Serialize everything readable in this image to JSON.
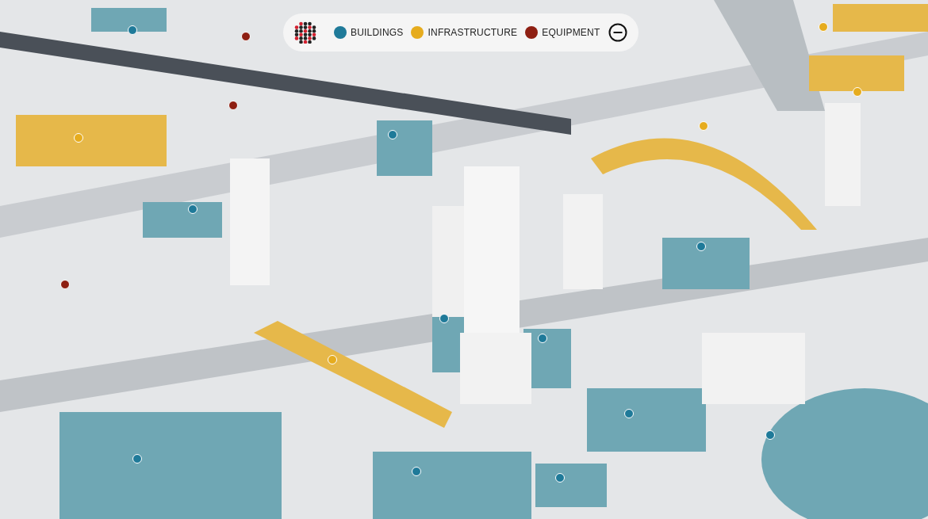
{
  "legend": {
    "items": [
      {
        "label": "BUILDINGS",
        "color": "#1f7a99"
      },
      {
        "label": "INFRASTRUCTURE",
        "color": "#e6ac1e"
      },
      {
        "label": "EQUIPMENT",
        "color": "#8e1f12"
      }
    ]
  },
  "pins": [
    {
      "color": "#1f7a99"
    },
    {
      "color": "#1f7a99"
    },
    {
      "color": "#1f7a99"
    },
    {
      "color": "#1f7a99"
    },
    {
      "color": "#1f7a99"
    },
    {
      "color": "#1f7a99"
    },
    {
      "color": "#1f7a99"
    },
    {
      "color": "#1f7a99"
    },
    {
      "color": "#1f7a99"
    },
    {
      "color": "#1f7a99"
    },
    {
      "color": "#1f7a99"
    },
    {
      "color": "#e6ac1e"
    },
    {
      "color": "#e6ac1e"
    },
    {
      "color": "#e6ac1e"
    },
    {
      "color": "#e6ac1e"
    },
    {
      "color": "#e6ac1e"
    },
    {
      "color": "#8e1f12"
    },
    {
      "color": "#8e1f12"
    },
    {
      "color": "#8e1f12"
    }
  ]
}
